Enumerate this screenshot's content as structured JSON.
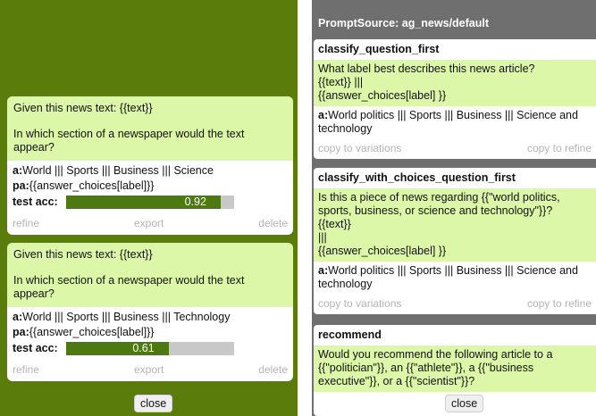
{
  "left": {
    "cards": [
      {
        "prompt_line1": "Given this news text: {{text}}",
        "prompt_line2": "In which section of a newspaper would the text appear?",
        "a_label": "a:",
        "a_value": "World ||| Sports ||| Business ||| Science",
        "pa_label": "pa:",
        "pa_value": "{{answer_choices[label]}}",
        "acc_label": "test acc:",
        "acc_value": "0.92",
        "acc_fraction": 0.92,
        "refine": "refine",
        "export": "export",
        "delete": "delete"
      },
      {
        "prompt_line1": "Given this news text: {{text}}",
        "prompt_line2": "In which section of a newspaper would the text appear?",
        "a_label": "a:",
        "a_value": "World ||| Sports ||| Business ||| Technology",
        "pa_label": "pa:",
        "pa_value": "{{answer_choices[label]}}",
        "acc_label": "test acc:",
        "acc_value": "0.61",
        "acc_fraction": 0.61,
        "refine": "refine",
        "export": "export",
        "delete": "delete"
      }
    ],
    "close_label": "close"
  },
  "right": {
    "header": "PromptSource: ag_news/default",
    "cards": [
      {
        "title": "classify_question_first",
        "prompt_lines": [
          "What label best describes this news article?",
          "{{text}} |||",
          "{{answer_choices[label] }}"
        ],
        "a_label": "a:",
        "a_value": "World politics ||| Sports ||| Business ||| Science and technology",
        "copy_variations": "copy to variations",
        "copy_refine": "copy to refine"
      },
      {
        "title": "classify_with_choices_question_first",
        "prompt_lines": [
          "Is this a piece of news regarding {{\"world politics, sports, business, or science and technology\"}}?",
          "{{text}}",
          "|||",
          "{{answer_choices[label] }}"
        ],
        "a_label": "a:",
        "a_value": "World politics ||| Sports ||| Business ||| Science and technology",
        "copy_variations": "copy to variations",
        "copy_refine": "copy to refine"
      },
      {
        "title": "recommend",
        "prompt_lines": [
          "Would you recommend the following article to a {{\"politician\"}}, an {{\"athlete\"}}, a {{\"business executive\"}}, or a {{\"scientist\"}}?"
        ]
      }
    ],
    "close_label": "close"
  },
  "colors": {
    "left_background": "#5a7c0a",
    "prompt_highlight": "#dcf7a8",
    "bar_fill": "#4c7a10",
    "right_background": "#6f6f6f"
  }
}
